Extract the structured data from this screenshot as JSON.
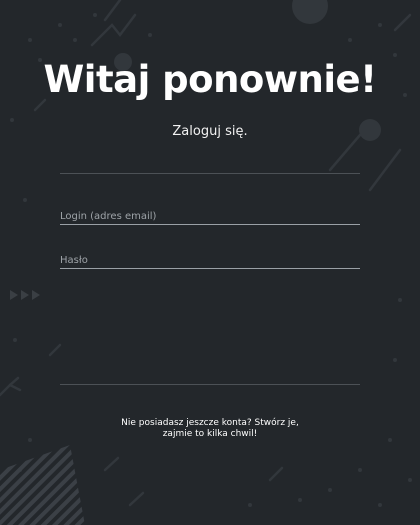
{
  "login": {
    "title": "Witaj ponownie!",
    "subtitle": "Zaloguj się.",
    "email_placeholder": "Login (adres email)",
    "email_value": "",
    "password_placeholder": "Hasło",
    "password_value": "",
    "register_link": "Nie posiadasz jeszcze konta? Stwórz je, zajmie to kilka chwil!"
  },
  "colors": {
    "background": "#23272b",
    "text": "#ffffff",
    "placeholder": "#9ea3a8",
    "underline": "#9aa0a6"
  }
}
